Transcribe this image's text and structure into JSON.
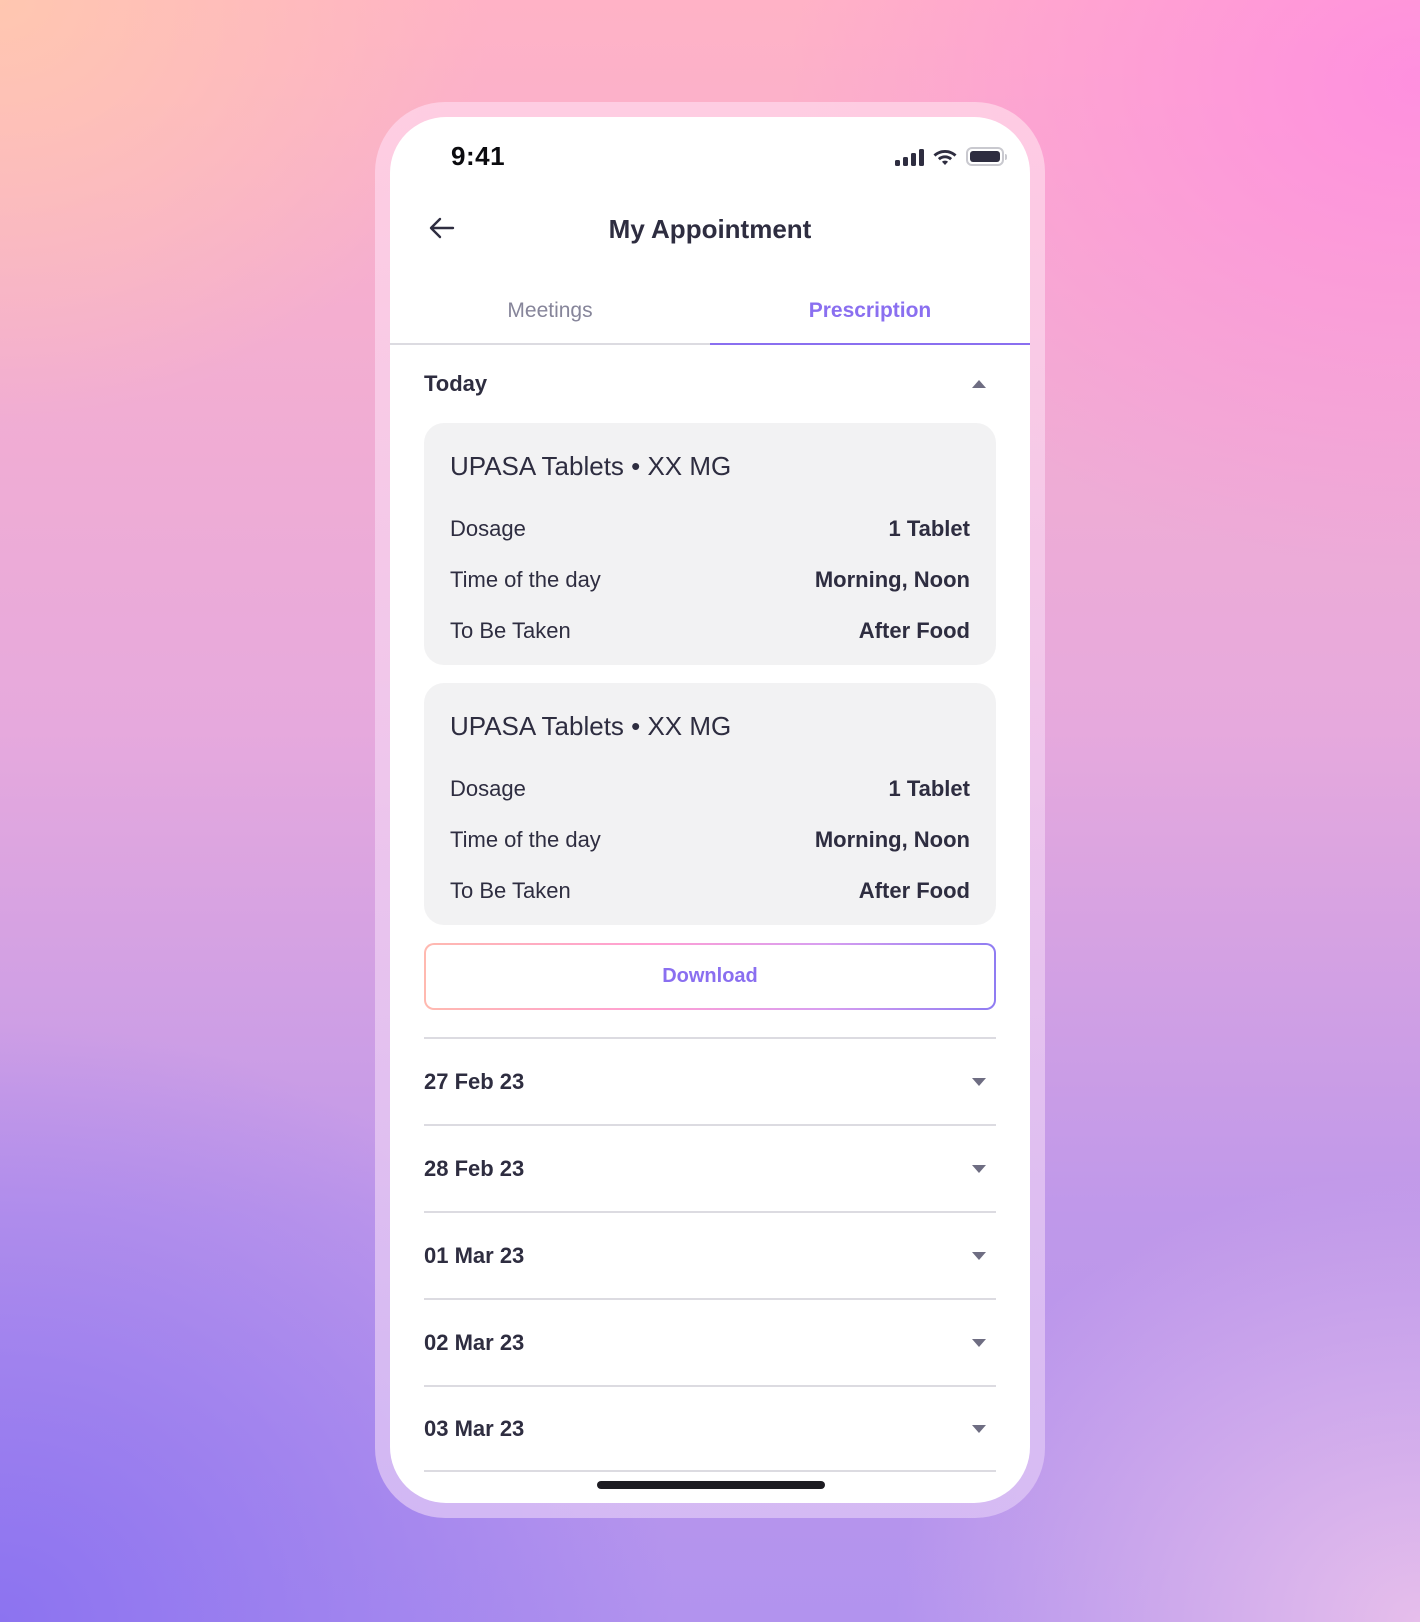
{
  "status_bar": {
    "time": "9:41",
    "icons": [
      "cellular-signal-icon",
      "wifi-icon",
      "battery-icon"
    ]
  },
  "nav": {
    "back_icon": "arrow-left-icon",
    "title": "My Appointment"
  },
  "tabs": [
    {
      "label": "Meetings",
      "active": false
    },
    {
      "label": "Prescription",
      "active": true
    }
  ],
  "today_section": {
    "title": "Today",
    "expanded": true,
    "toggle_icon": "caret-up-icon",
    "prescriptions": [
      {
        "title": "UPASA Tablets • XX MG",
        "rows": [
          {
            "label": "Dosage",
            "value": "1 Tablet"
          },
          {
            "label": "Time of the day",
            "value": "Morning, Noon"
          },
          {
            "label": "To Be Taken",
            "value": "After Food"
          }
        ]
      },
      {
        "title": "UPASA Tablets • XX MG",
        "rows": [
          {
            "label": "Dosage",
            "value": "1 Tablet"
          },
          {
            "label": "Time of the day",
            "value": "Morning, Noon"
          },
          {
            "label": "To Be Taken",
            "value": "After Food"
          }
        ]
      }
    ],
    "download_label": "Download"
  },
  "date_sections": [
    {
      "label": "27 Feb 23",
      "expanded": false
    },
    {
      "label": "28 Feb 23",
      "expanded": false
    },
    {
      "label": "01 Mar 23",
      "expanded": false
    },
    {
      "label": "02 Mar 23",
      "expanded": false
    },
    {
      "label": "03 Mar 23",
      "expanded": false
    }
  ],
  "colors": {
    "accent": "#8a6ff0",
    "text_primary": "#2e2d40",
    "text_muted": "#86859a",
    "card_bg": "#f2f2f3",
    "divider": "#dcdbe1"
  }
}
